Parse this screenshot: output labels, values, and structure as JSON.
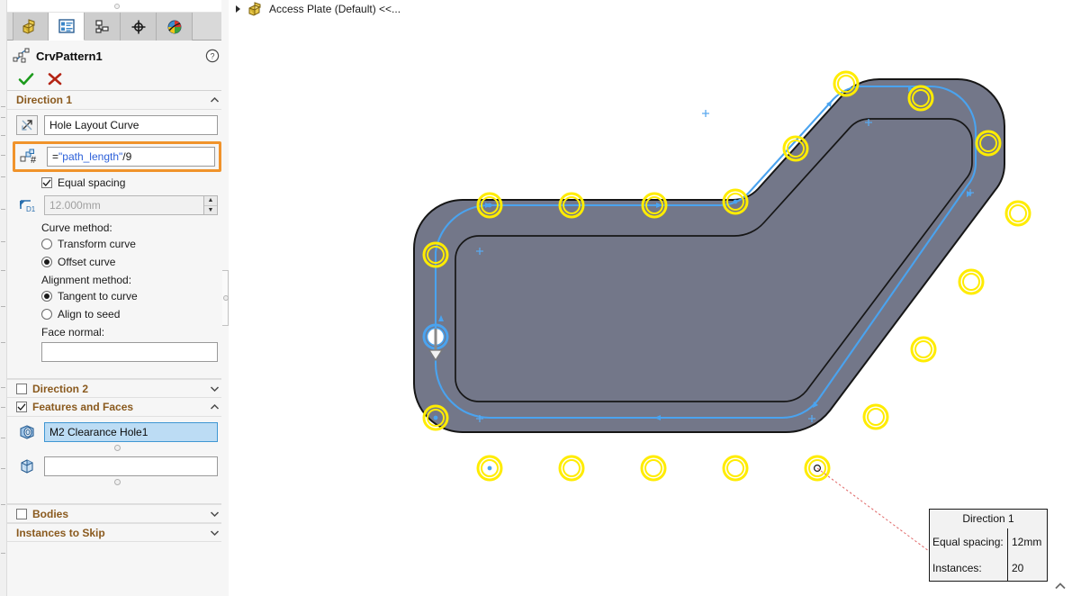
{
  "panel": {
    "tabs": [
      {
        "name": "feature-manager-design-tree-tab",
        "icon": "part-tree-icon",
        "active": false
      },
      {
        "name": "property-manager-tab",
        "icon": "property-list-icon",
        "active": true
      },
      {
        "name": "configuration-manager-tab",
        "icon": "configuration-icon",
        "active": false
      },
      {
        "name": "dimxpert-manager-tab",
        "icon": "crosshair-target-icon",
        "active": false
      },
      {
        "name": "display-manager-tab",
        "icon": "appearance-sphere-icon",
        "active": false
      }
    ],
    "feature": {
      "title": "CrvPattern1",
      "icon": "curve-driven-pattern-icon",
      "help_icon": "help-question-icon",
      "accept_icon": "green-check-icon",
      "cancel_icon": "red-x-icon"
    },
    "direction1": {
      "header": "Direction 1",
      "curve_icon": "pattern-direction-arrow-icon",
      "curve_value": "Hole Layout Curve",
      "count_icon": "instance-count-icon",
      "count_formula_prefix": "=",
      "count_formula_var": "\"path_length\"",
      "count_formula_suffix": "/9",
      "equal_spacing_label": "Equal spacing",
      "equal_spacing_checked": true,
      "spacing_icon": "spacing-dimension-icon",
      "spacing_value": "12.000mm",
      "spacing_disabled": true,
      "curve_method_label": "Curve method:",
      "curve_method_options": [
        "Transform curve",
        "Offset curve"
      ],
      "curve_method_selected": "Offset curve",
      "alignment_method_label": "Alignment method:",
      "alignment_method_options": [
        "Tangent to curve",
        "Align to seed"
      ],
      "alignment_method_selected": "Tangent to curve",
      "face_normal_label": "Face normal:",
      "face_normal_value": ""
    },
    "direction2": {
      "header": "Direction 2",
      "checked": false
    },
    "features_and_faces": {
      "header": "Features and Faces",
      "checked": true,
      "feature_icon": "hole-feature-icon",
      "feature_value": "M2 Clearance Hole1",
      "faces_icon": "face-solid-icon",
      "faces_value": ""
    },
    "bodies": {
      "header": "Bodies",
      "checked": false
    },
    "instances_to_skip": {
      "header": "Instances to Skip"
    }
  },
  "viewport": {
    "breadcrumb": {
      "expand_icon": "expand-triangle-icon",
      "part_icon": "part-yellow-icon",
      "label": "Access Plate (Default) <<..."
    },
    "scroll_icon": "chevron-up-icon",
    "callout": {
      "title": "Direction 1",
      "rows": [
        {
          "key": "Equal spacing:",
          "value": "12mm"
        },
        {
          "key": "Instances:",
          "value": "20"
        }
      ]
    },
    "colors": {
      "part_face": "#737789",
      "part_edge": "#1a1a1a",
      "path_curve": "#4aa3ef",
      "hole_ring": "#ffec00",
      "highlight_orange": "#f0932b",
      "leader_line": "#e06666",
      "selection_blue": "#bcdcf4"
    }
  }
}
